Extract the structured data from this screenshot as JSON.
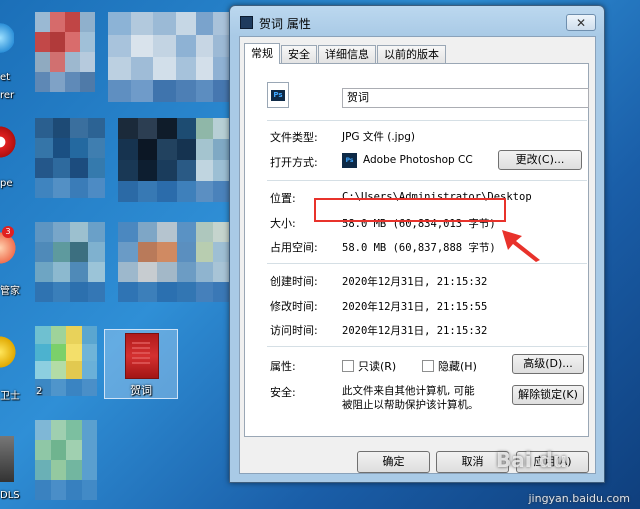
{
  "desktop": {
    "labels": [
      "et",
      "rer",
      "pe",
      "管家",
      "卫士",
      "2",
      "DLS"
    ],
    "selected_file_label": "贺词"
  },
  "dialog": {
    "title": "贺词 属性",
    "close_symbol": "✕",
    "tabs": [
      "常规",
      "安全",
      "详细信息",
      "以前的版本"
    ],
    "file_name": "贺词",
    "file_type_label": "文件类型:",
    "file_type_value": "JPG 文件 (.jpg)",
    "open_with_label": "打开方式:",
    "open_with_value": "Adobe Photoshop CC",
    "change_button": "更改(C)...",
    "location_label": "位置:",
    "location_value": "C:\\Users\\Administrator\\Desktop",
    "size_label": "大小:",
    "size_value": "58.0 MB (60,834,013 字节)",
    "disk_size_label": "占用空间:",
    "disk_size_value": "58.0 MB (60,837,888 字节)",
    "created_label": "创建时间:",
    "created_value": "2020年12月31日, 21:15:32",
    "modified_label": "修改时间:",
    "modified_value": "2020年12月31日, 21:15:55",
    "accessed_label": "访问时间:",
    "accessed_value": "2020年12月31日, 21:15:32",
    "attributes_label": "属性:",
    "readonly_label": "只读(R)",
    "hidden_label": "隐藏(H)",
    "advanced_button": "高级(D)...",
    "security_label": "安全:",
    "security_text_1": "此文件来自其他计算机, 可能",
    "security_text_2": "被阻止以帮助保护该计算机。",
    "unblock_button": "解除锁定(K)",
    "ok_button": "确定",
    "cancel_button": "取消",
    "apply_button": "应用(A)",
    "ps_icon_text": "Ps"
  },
  "watermark": {
    "logo": "Bai du",
    "site": "jingyan.baidu.com"
  },
  "colors": {
    "annotation_red": "#e8322b",
    "desktop_blue": "#1b6fb8"
  }
}
